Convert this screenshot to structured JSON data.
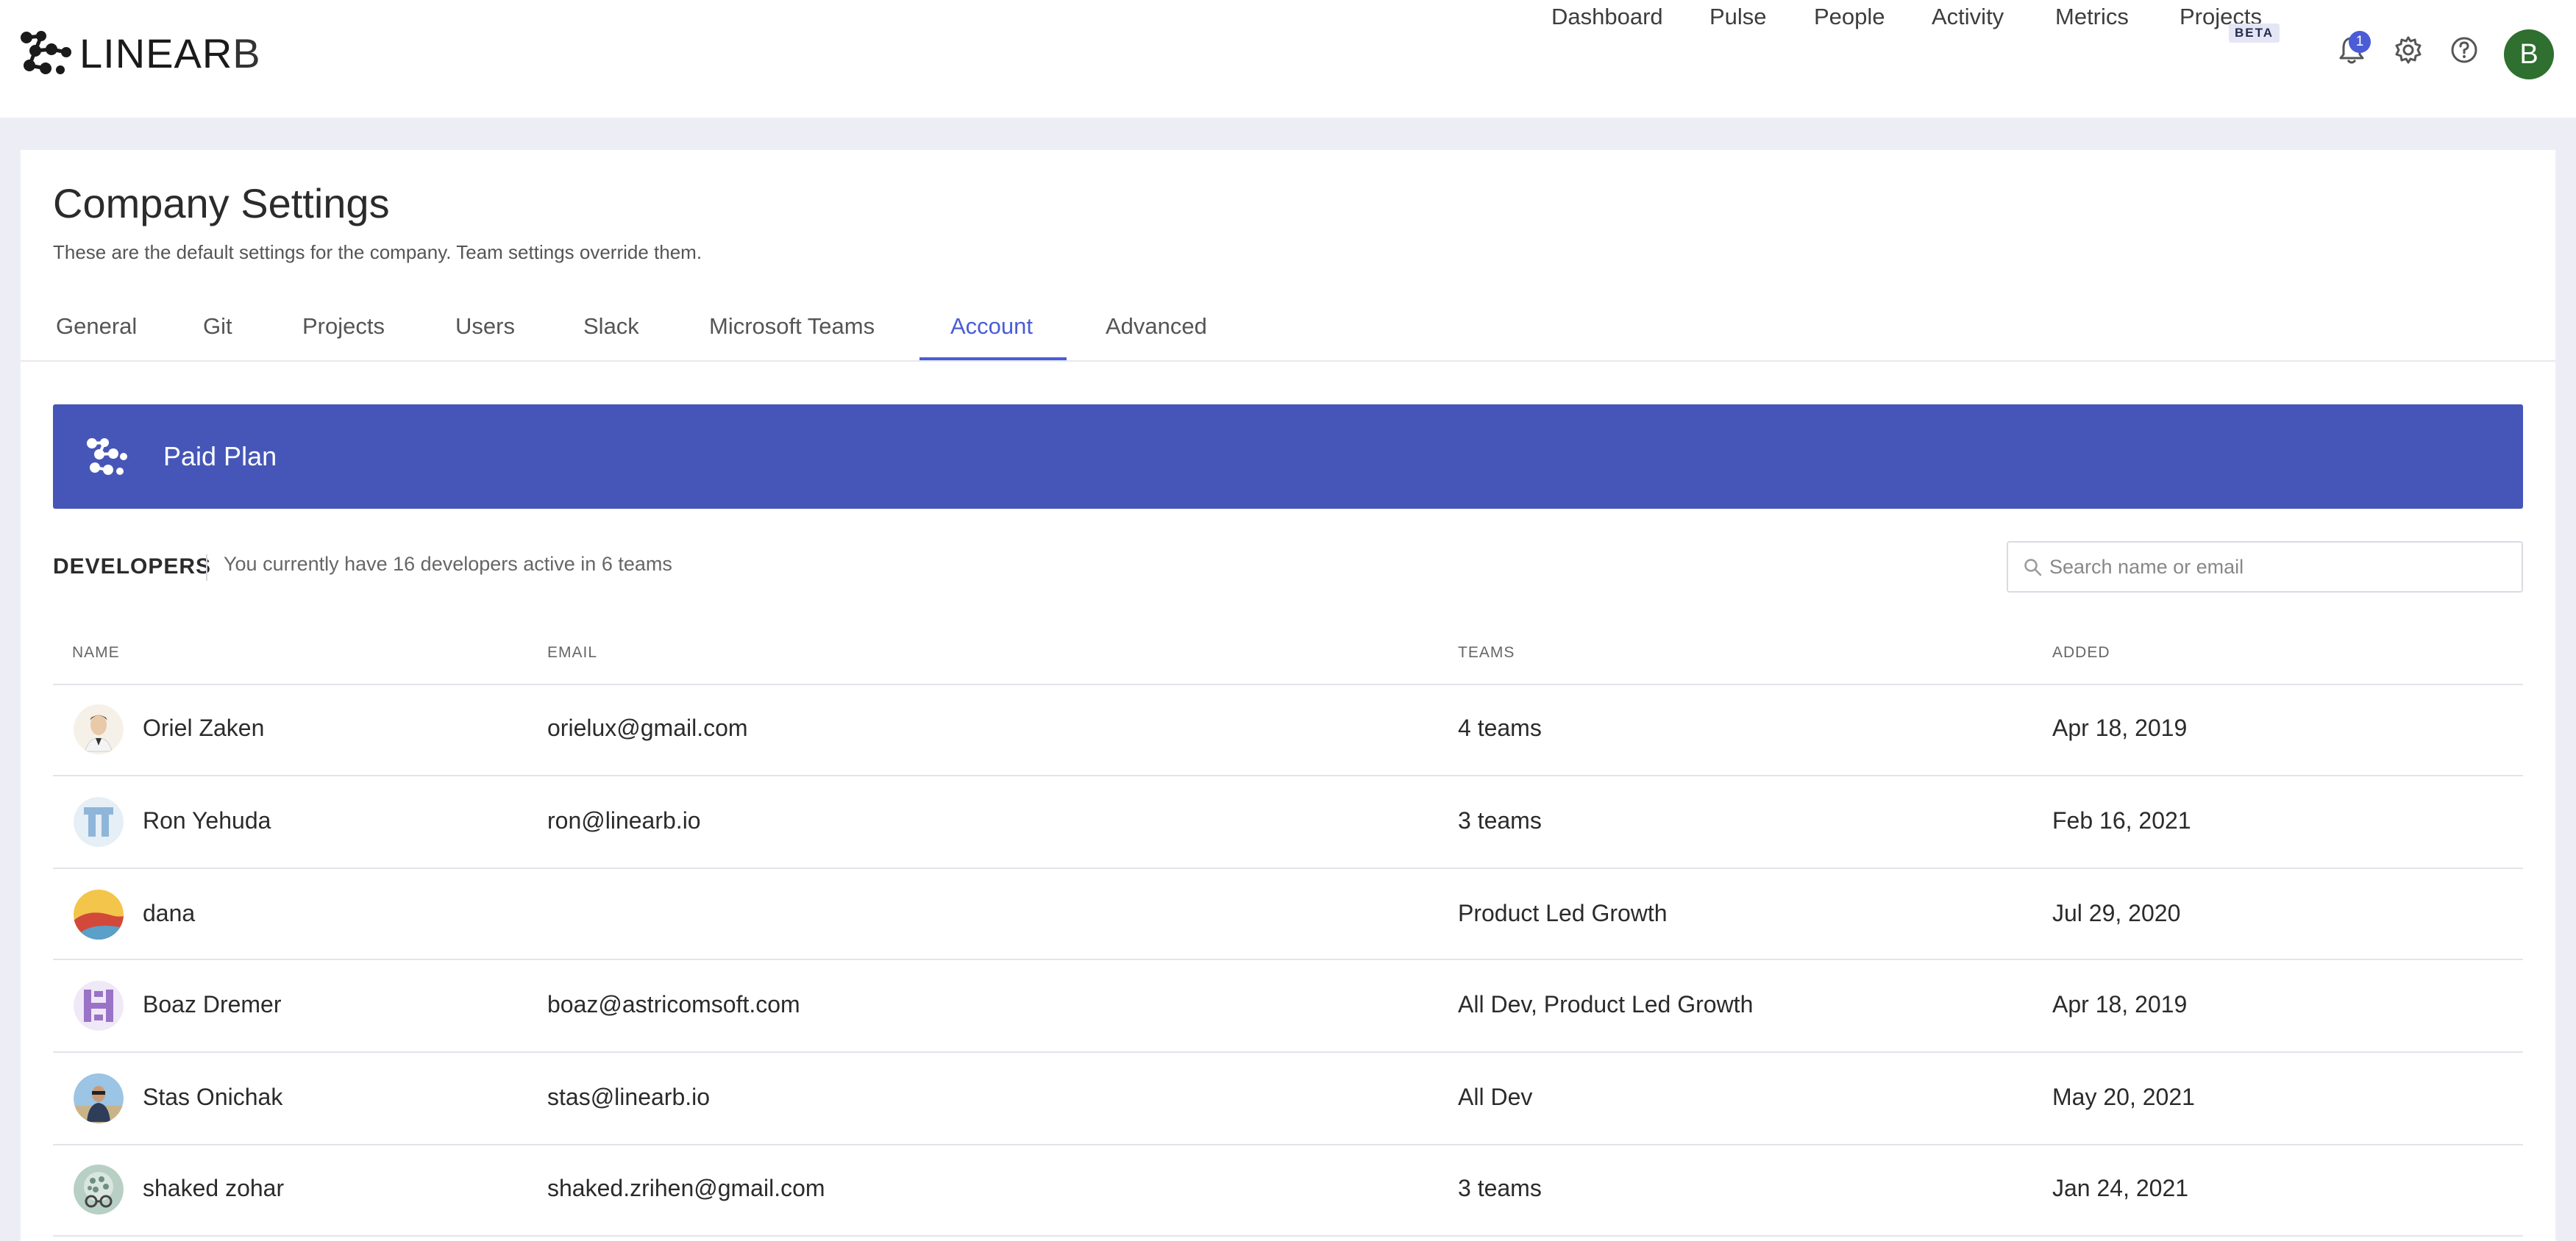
{
  "brand": {
    "name_main": "LINEAR",
    "name_end": "B"
  },
  "nav": {
    "items": [
      "Dashboard",
      "Pulse",
      "People",
      "Activity",
      "Metrics",
      "Projects"
    ],
    "beta_badge": "BETA",
    "notification_count": "1",
    "user_initial": "B"
  },
  "page": {
    "title": "Company Settings",
    "subtitle": "These are the default settings for the company. Team settings override them."
  },
  "tabs": [
    "General",
    "Git",
    "Projects",
    "Users",
    "Slack",
    "Microsoft Teams",
    "Account",
    "Advanced"
  ],
  "active_tab": "Account",
  "banner": {
    "text": "Paid Plan"
  },
  "developers": {
    "title": "DEVELOPERS",
    "summary": "You currently have 16 developers active in 6 teams",
    "search_placeholder": "Search name or email"
  },
  "table": {
    "headers": [
      "NAME",
      "EMAIL",
      "TEAMS",
      "ADDED"
    ],
    "rows": [
      {
        "name": "Oriel Zaken",
        "email": "orielux@gmail.com",
        "teams": "4 teams",
        "added": "Apr 18, 2019"
      },
      {
        "name": "Ron Yehuda",
        "email": "ron@linearb.io",
        "teams": "3 teams",
        "added": "Feb 16, 2021"
      },
      {
        "name": "dana",
        "email": "",
        "teams": "Product Led Growth",
        "added": "Jul 29, 2020"
      },
      {
        "name": "Boaz Dremer",
        "email": "boaz@astricomsoft.com",
        "teams": "All Dev, Product Led Growth",
        "added": "Apr 18, 2019"
      },
      {
        "name": "Stas Onichak",
        "email": "stas@linearb.io",
        "teams": "All Dev",
        "added": "May 20, 2021"
      },
      {
        "name": "shaked zohar",
        "email": "shaked.zrihen@gmail.com",
        "teams": "3 teams",
        "added": "Jan 24, 2021"
      }
    ]
  },
  "colors": {
    "accent": "#4a5cd6",
    "banner": "#4656b8",
    "background": "#edeef5",
    "avatar_bg": "#2f6f2f"
  }
}
